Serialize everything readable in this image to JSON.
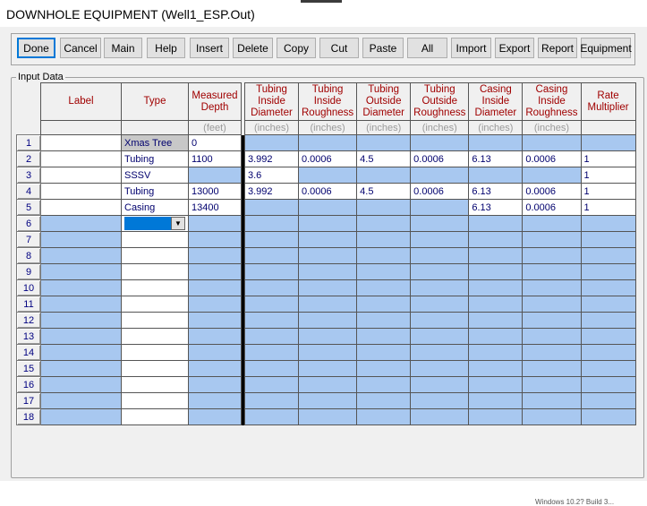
{
  "window": {
    "title": "DOWNHOLE EQUIPMENT (Well1_ESP.Out)"
  },
  "toolbar": {
    "buttons": [
      "Done",
      "Cancel",
      "Main",
      "Help",
      "Insert",
      "Delete",
      "Copy",
      "Cut",
      "Paste",
      "All",
      "Import",
      "Export",
      "Report",
      "Equipment"
    ]
  },
  "group": {
    "label": "Input Data"
  },
  "grid": {
    "headers": [
      "Label",
      "Type",
      "Measured Depth",
      "Tubing Inside Diameter",
      "Tubing Inside Roughness",
      "Tubing Outside Diameter",
      "Tubing Outside Roughness",
      "Casing Inside Diameter",
      "Casing Inside Roughness",
      "Rate Multiplier"
    ],
    "units": [
      "",
      "",
      "(feet)",
      "(inches)",
      "(inches)",
      "(inches)",
      "(inches)",
      "(inches)",
      "(inches)",
      ""
    ],
    "rows": [
      [
        "",
        "Xmas Tree",
        "0",
        "",
        "",
        "",
        "",
        "",
        "",
        ""
      ],
      [
        "",
        "Tubing",
        "1100",
        "3.992",
        "0.0006",
        "4.5",
        "0.0006",
        "6.13",
        "0.0006",
        "1"
      ],
      [
        "",
        "SSSV",
        "",
        "3.6",
        "",
        "",
        "",
        "",
        "",
        "1"
      ],
      [
        "",
        "Tubing",
        "13000",
        "3.992",
        "0.0006",
        "4.5",
        "0.0006",
        "6.13",
        "0.0006",
        "1"
      ],
      [
        "",
        "Casing",
        "13400",
        "",
        "",
        "",
        "",
        "6.13",
        "0.0006",
        "1"
      ],
      [
        "",
        "",
        "",
        "",
        "",
        "",
        "",
        "",
        "",
        ""
      ],
      [
        "",
        "",
        "",
        "",
        "",
        "",
        "",
        "",
        "",
        ""
      ],
      [
        "",
        "",
        "",
        "",
        "",
        "",
        "",
        "",
        "",
        ""
      ],
      [
        "",
        "",
        "",
        "",
        "",
        "",
        "",
        "",
        "",
        ""
      ],
      [
        "",
        "",
        "",
        "",
        "",
        "",
        "",
        "",
        "",
        ""
      ],
      [
        "",
        "",
        "",
        "",
        "",
        "",
        "",
        "",
        "",
        ""
      ],
      [
        "",
        "",
        "",
        "",
        "",
        "",
        "",
        "",
        "",
        ""
      ],
      [
        "",
        "",
        "",
        "",
        "",
        "",
        "",
        "",
        "",
        ""
      ],
      [
        "",
        "",
        "",
        "",
        "",
        "",
        "",
        "",
        "",
        ""
      ],
      [
        "",
        "",
        "",
        "",
        "",
        "",
        "",
        "",
        "",
        ""
      ],
      [
        "",
        "",
        "",
        "",
        "",
        "",
        "",
        "",
        "",
        ""
      ],
      [
        "",
        "",
        "",
        "",
        "",
        "",
        "",
        "",
        "",
        ""
      ],
      [
        "",
        "",
        "",
        "",
        "",
        "",
        "",
        "",
        "",
        ""
      ]
    ],
    "row_numbers": [
      "1",
      "2",
      "3",
      "4",
      "5",
      "6",
      "7",
      "8",
      "9",
      "10",
      "11",
      "12",
      "13",
      "14",
      "15",
      "16",
      "17",
      "18"
    ]
  },
  "status": {
    "text": "Windows 10.2? Build 3..."
  },
  "colors": {
    "editable": "#ffffff",
    "disabled": "#a8c8f0",
    "header_text": "#a00000",
    "value_text": "#00006e"
  }
}
